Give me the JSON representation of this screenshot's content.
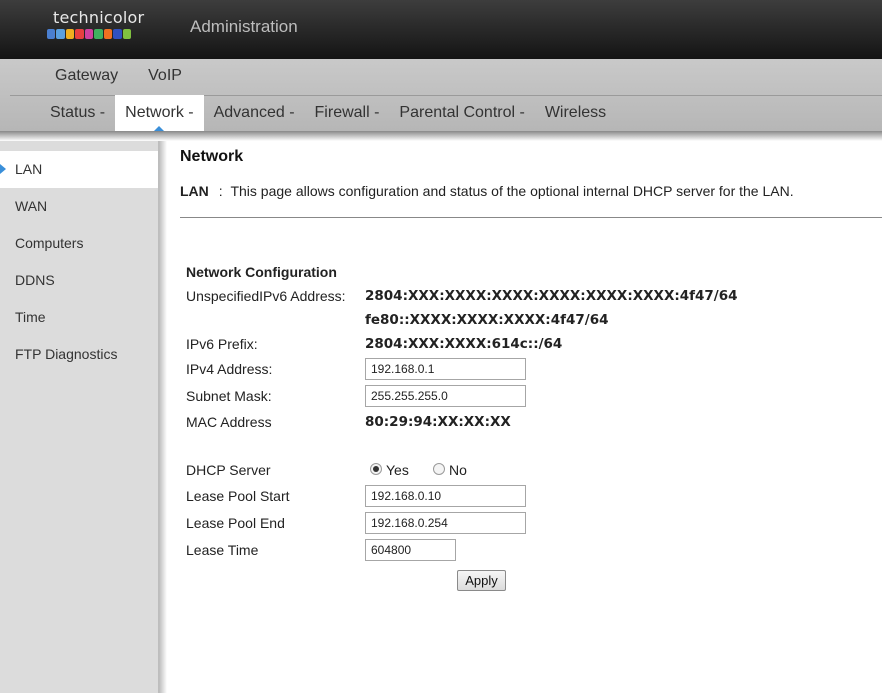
{
  "header": {
    "logo_text": "technicolor",
    "logo_colors": [
      "#4a7fd0",
      "#5aa0e0",
      "#f0b020",
      "#e84040",
      "#d040a0",
      "#40b060",
      "#f07020",
      "#3050c0",
      "#80c040"
    ],
    "title": "Administration"
  },
  "nav": {
    "primary": [
      "Gateway",
      "VoIP"
    ],
    "secondary": [
      "Status -",
      "Network -",
      "Advanced -",
      "Firewall -",
      "Parental Control -",
      "Wireless"
    ],
    "active_secondary": "Network -"
  },
  "sidebar": {
    "items": [
      "LAN",
      "WAN",
      "Computers",
      "DDNS",
      "Time",
      "FTP Diagnostics"
    ],
    "active": "LAN"
  },
  "main": {
    "title": "Network",
    "desc_key": "LAN",
    "desc_sep": ":",
    "desc_text": "This page allows configuration and status of the optional internal DHCP server for the LAN.",
    "section_title": "Network Configuration",
    "ipv6_label": "UnspecifiedIPv6 Address:",
    "ipv6_value_1": "2804:XXX:XXXX:XXXX:XXXX:XXXX:XXXX:4f47/64",
    "ipv6_value_2": "fe80::XXXX:XXXX:XXXX:4f47/64",
    "prefix_label": "IPv6 Prefix:",
    "prefix_value": "2804:XXX:XXXX:614c::/64",
    "ipv4_label": "IPv4 Address:",
    "ipv4_value": "192.168.0.1",
    "subnet_label": "Subnet Mask:",
    "subnet_value": "255.255.255.0",
    "mac_label": "MAC Address",
    "mac_value": "80:29:94:XX:XX:XX",
    "dhcp_label": "DHCP Server",
    "dhcp_yes": "Yes",
    "dhcp_no": "No",
    "dhcp_selected": "Yes",
    "pool_start_label": "Lease Pool Start",
    "pool_start_value": "192.168.0.10",
    "pool_end_label": "Lease Pool End",
    "pool_end_value": "192.168.0.254",
    "lease_time_label": "Lease Time",
    "lease_time_value": "604800",
    "apply_label": "Apply"
  }
}
